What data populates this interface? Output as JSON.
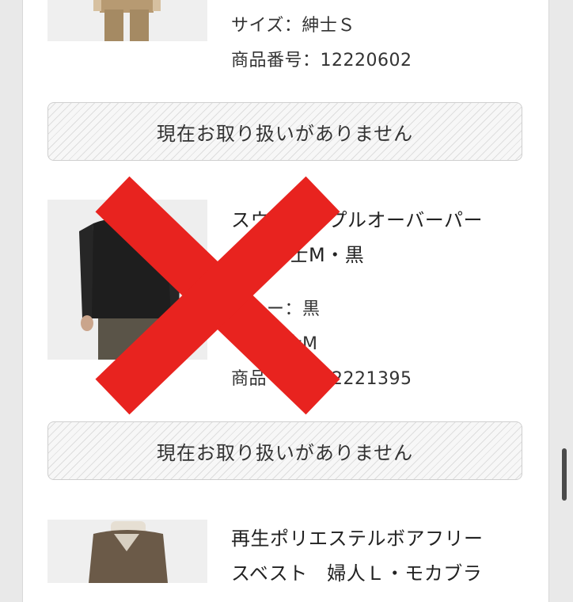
{
  "items": [
    {
      "size": "サイズ：紳士Ｓ",
      "product_no": "商品番号：12220602",
      "availability": "現在お取り扱いがありません"
    },
    {
      "title_line1": "スウ　　　プルオーバーパー",
      "title_line2": "　　紳士M・黒",
      "color": "　　ー：黒",
      "size": "　　紳士M",
      "product_no": "商品　　　12221395",
      "availability": "現在お取り扱いがありません"
    },
    {
      "title_line1": "再生ポリエステルボアフリー",
      "title_line2": "スベスト　婦人Ｌ・モカブラ"
    }
  ],
  "overlay": {
    "icon": "red-x-icon",
    "color": "#e8231f"
  }
}
